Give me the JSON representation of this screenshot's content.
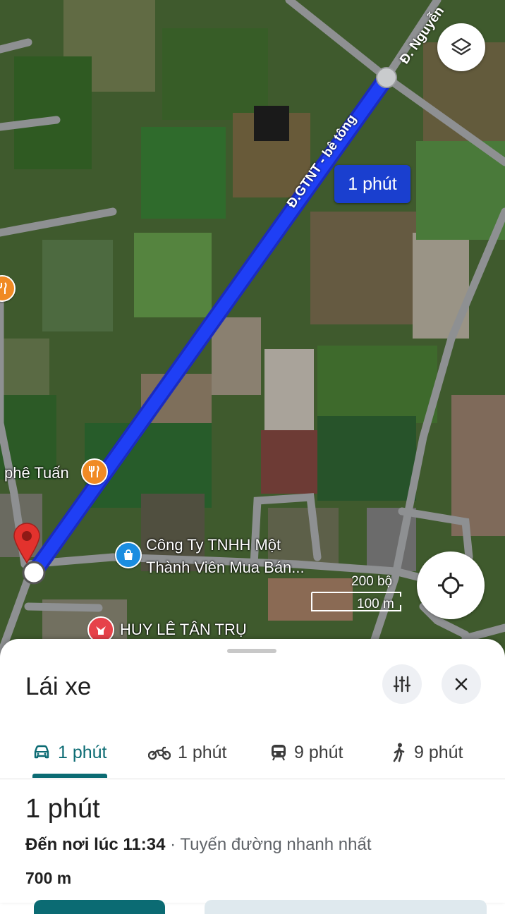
{
  "map": {
    "route_duration_chip": "1 phút",
    "road_labels": {
      "main_road": "Đ.GTNT - bê tông",
      "top_road": "Đ. Nguyễn"
    },
    "poi": {
      "cafe": "phê Tuấn",
      "company_line1": "Công Ty TNHH Một",
      "company_line2": "Thành Viên Mua Bán...",
      "shop": "HUY LÊ TÂN TRỤ"
    },
    "scale": {
      "imperial": "200 bộ",
      "metric": "100 m"
    },
    "icons": {
      "layers": "layers-icon",
      "my_location": "my-location-icon"
    },
    "colors": {
      "route": "#1f3ff5",
      "destination_pin": "#e3322d",
      "cafe_pin": "#f08a24",
      "company_pin": "#1a8de0",
      "shop_pin": "#e6424a"
    }
  },
  "sheet": {
    "title": "Lái xe",
    "modes": [
      {
        "icon": "car-icon",
        "label": "1 phút",
        "active": true
      },
      {
        "icon": "motorbike-icon",
        "label": "1 phút"
      },
      {
        "icon": "transit-icon",
        "label": "9 phút"
      },
      {
        "icon": "walk-icon",
        "label": "9 phút"
      }
    ],
    "route": {
      "duration": "1 phút",
      "arrival": "Đến nơi lúc 11:34",
      "separator": " · ",
      "note": "Tuyến đường nhanh nhất",
      "distance": "700 m"
    },
    "colors": {
      "accent": "#0b6b73"
    }
  }
}
